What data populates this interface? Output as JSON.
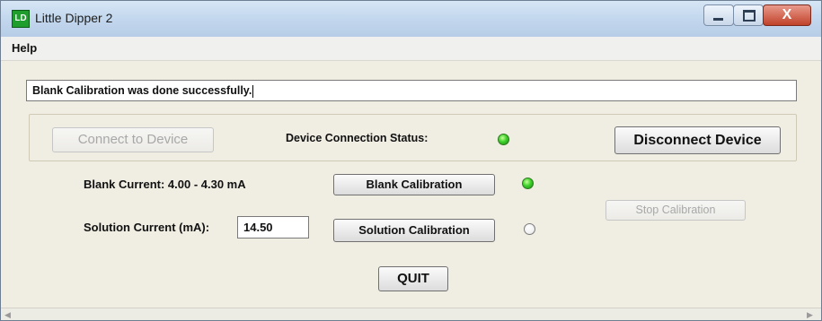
{
  "window": {
    "app_icon_text": "LD",
    "title": "Little Dipper 2",
    "close_symbol": "X"
  },
  "menu": {
    "help": "Help"
  },
  "status_message": "Blank Calibration was done successfully.",
  "connection": {
    "connect_label": "Connect to Device",
    "status_label": "Device Connection Status:",
    "status_led": "green",
    "disconnect_label": "Disconnect Device"
  },
  "calibration": {
    "blank_current_label": "Blank Current: 4.00 - 4.30 mA",
    "blank_button": "Blank Calibration",
    "blank_led": "green",
    "solution_current_label": "Solution Current (mA):",
    "solution_current_value": "14.50",
    "solution_button": "Solution Calibration",
    "solution_led": "off",
    "stop_button": "Stop Calibration"
  },
  "quit_label": "QUIT",
  "colors": {
    "led_green": "#3fd12c",
    "window_background": "#f0ede2",
    "titlebar": "#c4d8ee"
  }
}
